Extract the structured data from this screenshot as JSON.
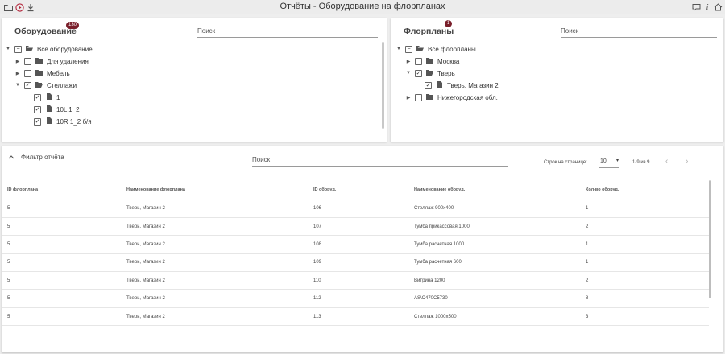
{
  "window": {
    "title": "Отчёты - Оборудование на флорпланах",
    "left_icons": [
      "folder-icon",
      "record-icon",
      "download-icon"
    ],
    "right_icons": [
      "chat-icon",
      "info-icon",
      "home-icon"
    ]
  },
  "equipment": {
    "title": "Оборудование",
    "count": "130",
    "search_placeholder": "Поиск",
    "tree": [
      {
        "label": "Все оборудование",
        "level": 0,
        "caret": "down",
        "check": "partial",
        "icon": "folder-open"
      },
      {
        "label": "Для удаления",
        "level": 1,
        "caret": "right",
        "check": "unchecked",
        "icon": "folder"
      },
      {
        "label": "Мебель",
        "level": 1,
        "caret": "right",
        "check": "unchecked",
        "icon": "folder"
      },
      {
        "label": "Стеллажи",
        "level": 1,
        "caret": "down",
        "check": "checked",
        "icon": "folder-open"
      },
      {
        "label": "1",
        "level": 2,
        "caret": "none",
        "check": "checked",
        "icon": "file"
      },
      {
        "label": "10L 1_2",
        "level": 2,
        "caret": "none",
        "check": "checked",
        "icon": "file"
      },
      {
        "label": "10R 1_2 б/я",
        "level": 2,
        "caret": "none",
        "check": "checked",
        "icon": "file"
      }
    ]
  },
  "floorplans": {
    "title": "Флорпланы",
    "count": "1",
    "search_placeholder": "Поиск",
    "tree": [
      {
        "label": "Все флорпланы",
        "level": 0,
        "caret": "down",
        "check": "partial",
        "icon": "folder-open"
      },
      {
        "label": "Москва",
        "level": 1,
        "caret": "right",
        "check": "unchecked",
        "icon": "folder"
      },
      {
        "label": "Тверь",
        "level": 1,
        "caret": "down",
        "check": "checked",
        "icon": "folder-open"
      },
      {
        "label": "Тверь, Магазин 2",
        "level": 2,
        "caret": "none",
        "check": "checked",
        "icon": "file"
      },
      {
        "label": "Нижегородская обл.",
        "level": 1,
        "caret": "right",
        "check": "unchecked",
        "icon": "folder"
      }
    ]
  },
  "report": {
    "filter_label": "Фильтр отчёта",
    "search_placeholder": "Поиск",
    "rows_per_page_label": "Строк на странице:",
    "rows_per_page": "10",
    "range": "1-9 из 9",
    "columns": [
      "ID флорплана",
      "Наименование флорплана",
      "ID оборуд.",
      "Наименование оборуд.",
      "Кол-во оборуд."
    ],
    "rows": [
      [
        "5",
        "Тверь, Магазин 2",
        "106",
        "Стеллаж 900х400",
        "1"
      ],
      [
        "5",
        "Тверь, Магазин 2",
        "107",
        "Тумба прикассовая 1000",
        "2"
      ],
      [
        "5",
        "Тверь, Магазин 2",
        "108",
        "Тумба расчетная 1000",
        "1"
      ],
      [
        "5",
        "Тверь, Магазин 2",
        "109",
        "Тумба расчетная 600",
        "1"
      ],
      [
        "5",
        "Тверь, Магазин 2",
        "110",
        "Витрина 1200",
        "2"
      ],
      [
        "5",
        "Тверь, Магазин 2",
        "112",
        "AS\\C470C5730",
        "8"
      ],
      [
        "5",
        "Тверь, Магазин 2",
        "113",
        "Стеллаж 1000х500",
        "3"
      ]
    ]
  }
}
